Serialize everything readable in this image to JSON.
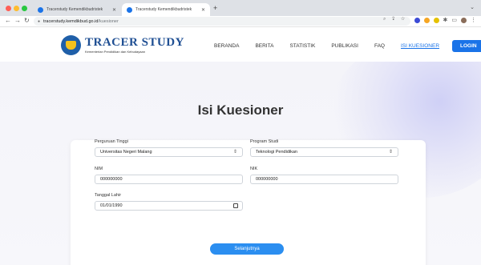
{
  "browser": {
    "tabs": [
      {
        "title": "Tracerstudy Kemendikbudristek"
      },
      {
        "title": "Tracerstudy Kemendikbudristek"
      }
    ],
    "url_host": "tracerstudy.kemdikbud.go.id",
    "url_path": "/kuesioner"
  },
  "site": {
    "logo_title": "TRACER STUDY",
    "logo_subtitle": "Kementerian Pendidikan dan Kebudayaan",
    "nav": [
      {
        "label": "BERANDA"
      },
      {
        "label": "BERITA"
      },
      {
        "label": "STATISTIK"
      },
      {
        "label": "PUBLIKASI"
      },
      {
        "label": "FAQ"
      },
      {
        "label": "ISI KUESIONER"
      }
    ],
    "login_label": "LOGIN"
  },
  "page": {
    "title": "Isi Kuesioner"
  },
  "form": {
    "perguruan_tinggi": {
      "label": "Perguruan Tinggi",
      "value": "Universitas Negeri Malang"
    },
    "program_studi": {
      "label": "Program Studi",
      "value": "Teknologi Pendidikan"
    },
    "nim": {
      "label": "NIM",
      "value": "000000000"
    },
    "nik": {
      "label": "NIK",
      "value": "000000000"
    },
    "tanggal_lahir": {
      "label": "Tanggal Lahir",
      "value": "01/01/1990"
    },
    "submit_label": "Selanjutnya"
  },
  "colors": {
    "accent": "#1a73e8",
    "logo_blue": "#1f4f93",
    "button_blue": "#2b8ef0"
  }
}
